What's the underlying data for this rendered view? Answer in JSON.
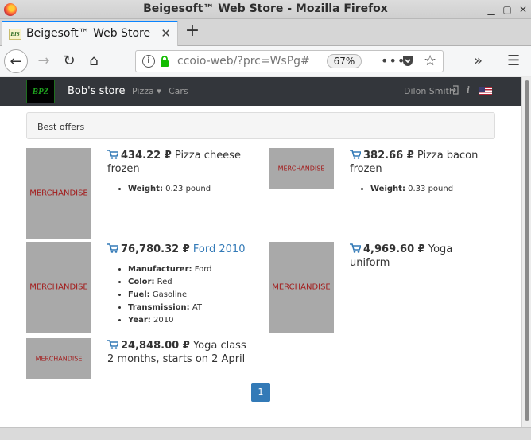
{
  "window": {
    "title": "Beigesoft™ Web Store - Mozilla Firefox"
  },
  "tab": {
    "title": "Beigesoft™ Web Store",
    "favicon_text": "EIS"
  },
  "urlbar": {
    "url": "ccoio-web/?prc=WsPg#",
    "zoom": "67%"
  },
  "site": {
    "logo_text": "BPZ",
    "brand": "Bob's store",
    "nav": [
      {
        "label": "Pizza ▾"
      },
      {
        "label": "Cars"
      }
    ],
    "user": "Dilon Smith",
    "info_label": "i"
  },
  "panel": {
    "title": "Best offers"
  },
  "products": [
    {
      "image_label": "MERCHANDISE",
      "price": "434.22 ₽",
      "name": "Pizza cheese frozen",
      "attrs": [
        {
          "label": "Weight:",
          "value": "0.23 pound"
        }
      ]
    },
    {
      "image_label": "MERCHANDISE",
      "price": "382.66 ₽",
      "name": "Pizza bacon frozen",
      "attrs": [
        {
          "label": "Weight:",
          "value": "0.33 pound"
        }
      ]
    },
    {
      "image_label": "MERCHANDISE",
      "price": "76,780.32 ₽",
      "name": "Ford 2010",
      "attrs": [
        {
          "label": "Manufacturer:",
          "value": "Ford"
        },
        {
          "label": "Color:",
          "value": "Red"
        },
        {
          "label": "Fuel:",
          "value": "Gasoline"
        },
        {
          "label": "Transmission:",
          "value": "AT"
        },
        {
          "label": "Year:",
          "value": "2010"
        }
      ]
    },
    {
      "image_label": "MERCHANDISE",
      "price": "4,969.60 ₽",
      "name": "Yoga uniform",
      "attrs": []
    },
    {
      "image_label": "MERCHANDISE",
      "price": "24,848.00 ₽",
      "name": "Yoga class 2 months, starts on 2 April",
      "attrs": []
    }
  ],
  "pagination": {
    "current": "1"
  },
  "colors": {
    "site_nav_bg": "#33363b",
    "link": "#337ab7",
    "merch_bg": "#a9a9a9",
    "merch_text": "#a31b1b",
    "accent_tab": "#0a84ff"
  }
}
